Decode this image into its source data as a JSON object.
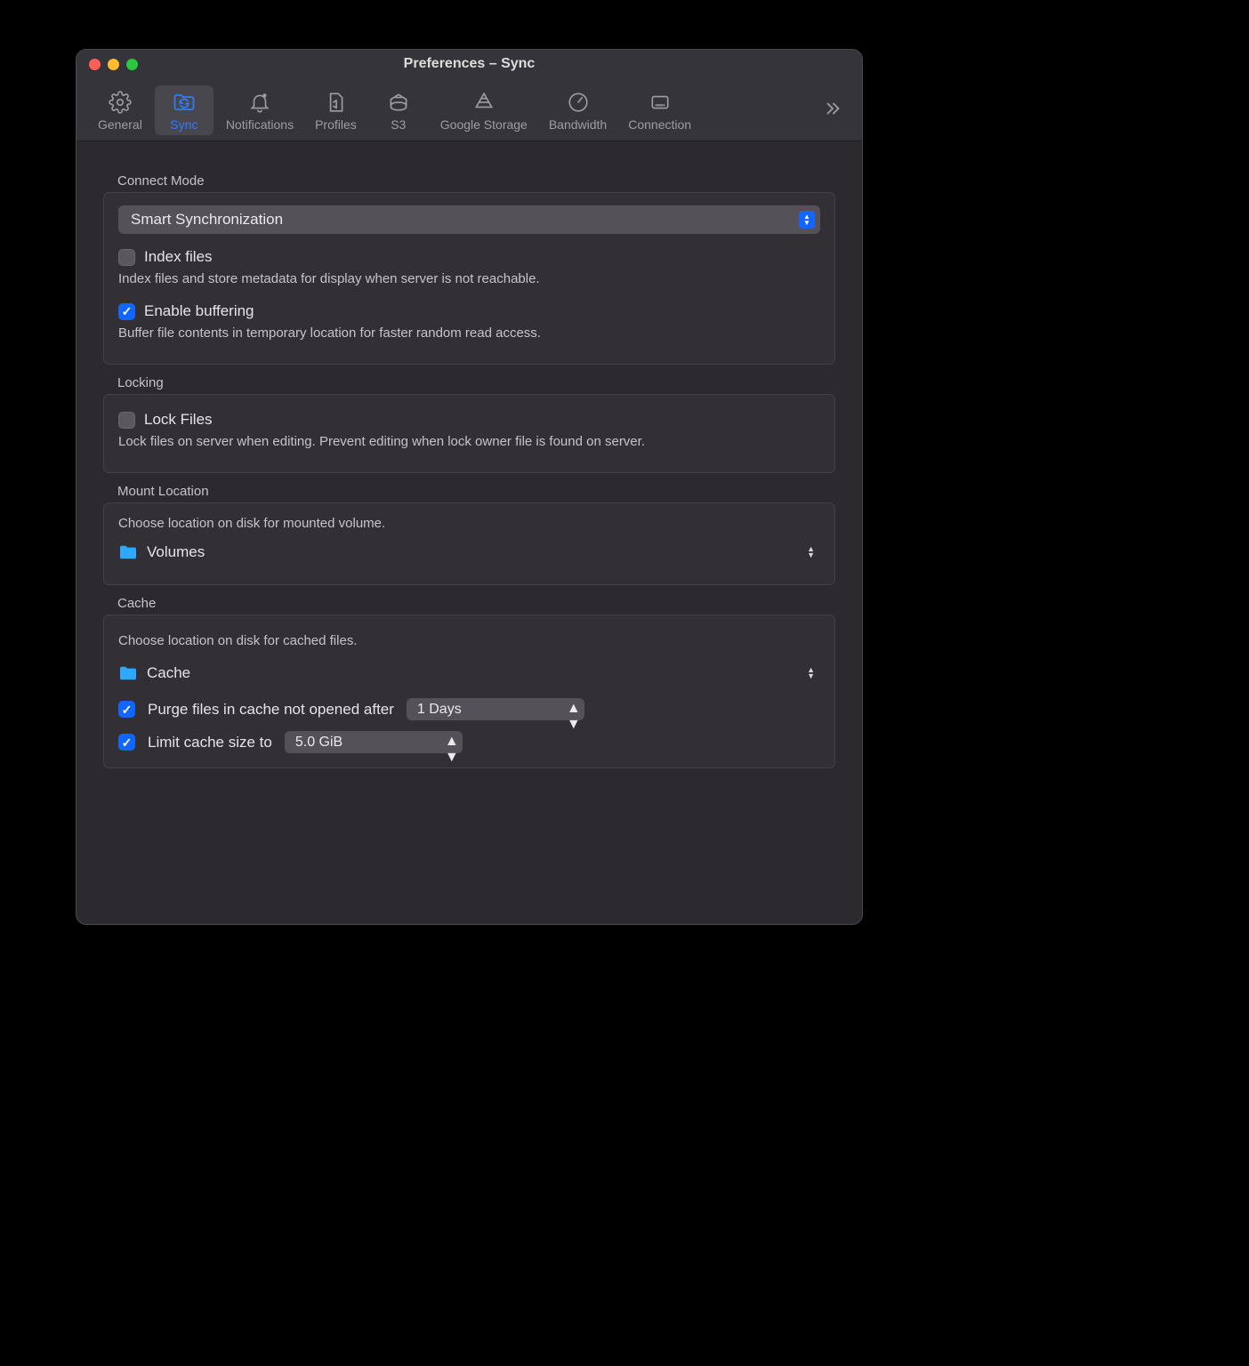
{
  "window": {
    "title": "Preferences – Sync"
  },
  "tabs": [
    {
      "label": "General"
    },
    {
      "label": "Sync"
    },
    {
      "label": "Notifications"
    },
    {
      "label": "Profiles"
    },
    {
      "label": "S3"
    },
    {
      "label": "Google Storage"
    },
    {
      "label": "Bandwidth"
    },
    {
      "label": "Connection"
    }
  ],
  "connect_mode": {
    "section": "Connect Mode",
    "mode": "Smart Synchronization",
    "index_label": "Index files",
    "index_hint": "Index files and store metadata for display when server is not reachable.",
    "buffer_label": "Enable buffering",
    "buffer_hint": "Buffer file contents in temporary location for faster random read access."
  },
  "locking": {
    "section": "Locking",
    "lock_label": "Lock Files",
    "lock_hint": "Lock files on server when editing. Prevent editing when lock owner file is found on server."
  },
  "mount": {
    "section": "Mount Location",
    "hint": "Choose location on disk for mounted volume.",
    "folder": "Volumes"
  },
  "cache": {
    "section": "Cache",
    "hint": "Choose location on disk for cached files.",
    "folder": "Cache",
    "purge_label": "Purge files in cache not opened after",
    "purge_value": "1 Days",
    "limit_label": "Limit cache size to",
    "limit_value": "5.0 GiB"
  }
}
